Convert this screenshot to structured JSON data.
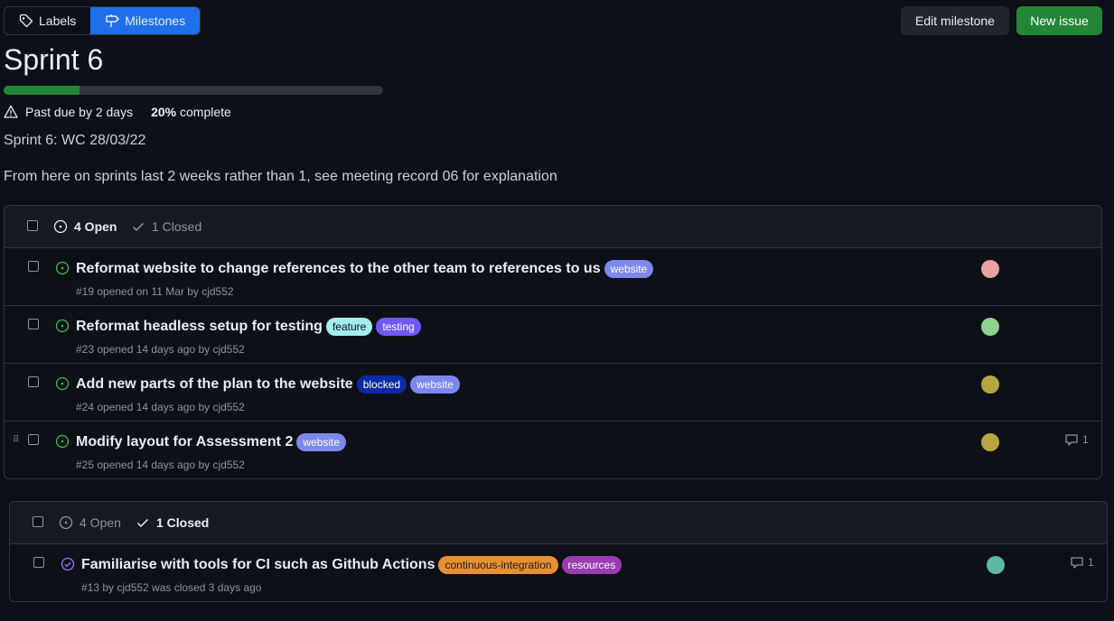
{
  "toolbar": {
    "labels_tab": "Labels",
    "milestones_tab": "Milestones",
    "edit_milestone": "Edit milestone",
    "new_issue": "New issue"
  },
  "milestone": {
    "title": "Sprint 6",
    "progress_fraction": 0.2,
    "due_status": "Past due by 2 days",
    "percent_value": "20%",
    "percent_suffix": "complete",
    "description_line1": "Sprint 6: WC 28/03/22",
    "description_line2": "From here on sprints last 2 weeks rather than 1, see meeting record 06 for explanation"
  },
  "open_list": {
    "open_label": "4 Open",
    "closed_label": "1 Closed",
    "issues": [
      {
        "title": "Reformat website to change references to the other team to references to us",
        "labels": [
          {
            "text": "website",
            "bg": "#7c88f0",
            "fg": "#ffffff"
          }
        ],
        "sub": "#19 opened on 11 Mar by cjd552",
        "avatar_color": "#e8a0a0"
      },
      {
        "title": "Reformat headless setup for testing",
        "labels": [
          {
            "text": "feature",
            "bg": "#a2eeef",
            "fg": "#0d1117"
          },
          {
            "text": "testing",
            "bg": "#7057ff",
            "fg": "#ffffff"
          }
        ],
        "sub": "#23 opened 14 days ago by cjd552",
        "avatar_color": "#8fd18f"
      },
      {
        "title": "Add new parts of the plan to the website",
        "labels": [
          {
            "text": "blocked",
            "bg": "#0b2ba3",
            "fg": "#ffffff"
          },
          {
            "text": "website",
            "bg": "#7c88f0",
            "fg": "#ffffff"
          }
        ],
        "sub": "#24 opened 14 days ago by cjd552",
        "avatar_color": "#b5a642"
      },
      {
        "title": "Modify layout for Assessment 2",
        "labels": [
          {
            "text": "website",
            "bg": "#7c88f0",
            "fg": "#ffffff"
          }
        ],
        "sub": "#25 opened 14 days ago by cjd552",
        "avatar_color": "#b5a642",
        "comments": "1"
      }
    ]
  },
  "closed_list": {
    "open_label": "4 Open",
    "closed_label": "1 Closed",
    "issues": [
      {
        "title": "Familiarise with tools for CI such as Github Actions",
        "labels": [
          {
            "text": "continuous-integration",
            "bg": "#e99034",
            "fg": "#1a1a1a"
          },
          {
            "text": "resources",
            "bg": "#9a3db3",
            "fg": "#ffffff"
          }
        ],
        "sub": "#13 by cjd552 was closed 3 days ago",
        "avatar_color": "#5fb8a0",
        "comments": "1"
      }
    ]
  },
  "colors": {
    "open_icon": "#3fb950",
    "closed_icon": "#a371f7",
    "accent_blue": "#1f6feb",
    "accent_green": "#238636"
  }
}
